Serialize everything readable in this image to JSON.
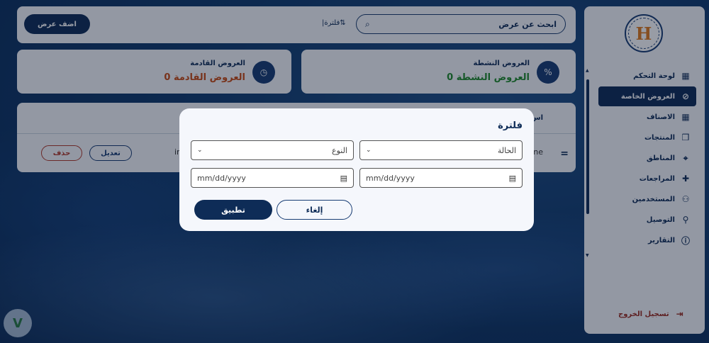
{
  "sidebar": {
    "logo_text": "H",
    "items": [
      {
        "label": "لوحة التحكم",
        "icon": "grid-icon",
        "glyph": "▦",
        "active": false
      },
      {
        "label": "العروض الخاصة",
        "icon": "percent-badge-icon",
        "glyph": "⊘",
        "active": true
      },
      {
        "label": "الاصناف",
        "icon": "categories-icon",
        "glyph": "▦",
        "active": false
      },
      {
        "label": "المنتجات",
        "icon": "box-icon",
        "glyph": "❒",
        "active": false
      },
      {
        "label": "المناطق",
        "icon": "map-icon",
        "glyph": "⌖",
        "active": false
      },
      {
        "label": "المراجعات",
        "icon": "review-icon",
        "glyph": "✚",
        "active": false
      },
      {
        "label": "المستخدمين",
        "icon": "users-icon",
        "glyph": "⚇",
        "active": false
      },
      {
        "label": "التوصيل",
        "icon": "bicycle-icon",
        "glyph": "⚲",
        "active": false
      },
      {
        "label": "التقارير",
        "icon": "info-icon",
        "glyph": "ⓘ",
        "active": false
      }
    ],
    "logout_label": "تسجيل الخروج"
  },
  "header": {
    "search_placeholder": "ابحث عن عرض",
    "filter_label": "فلترة",
    "add_button": "اضف عرض"
  },
  "stats": {
    "active_title": "العروض النشطة",
    "active_value": "0 العروض النشطة",
    "upcoming_title": "العروض القادمة",
    "upcoming_value": "0 العروض القادمة"
  },
  "table": {
    "header_partial": "اس",
    "row_name_partial": "ne",
    "row_mid_partial": "in",
    "edit_label": "تعديل",
    "delete_label": "حذف"
  },
  "modal": {
    "title": "فلترة",
    "status_placeholder": "الحالة",
    "type_placeholder": "النوع",
    "date_placeholder": "mm/dd/yyyy",
    "cancel_label": "إلغاء",
    "apply_label": "تطبيق"
  }
}
